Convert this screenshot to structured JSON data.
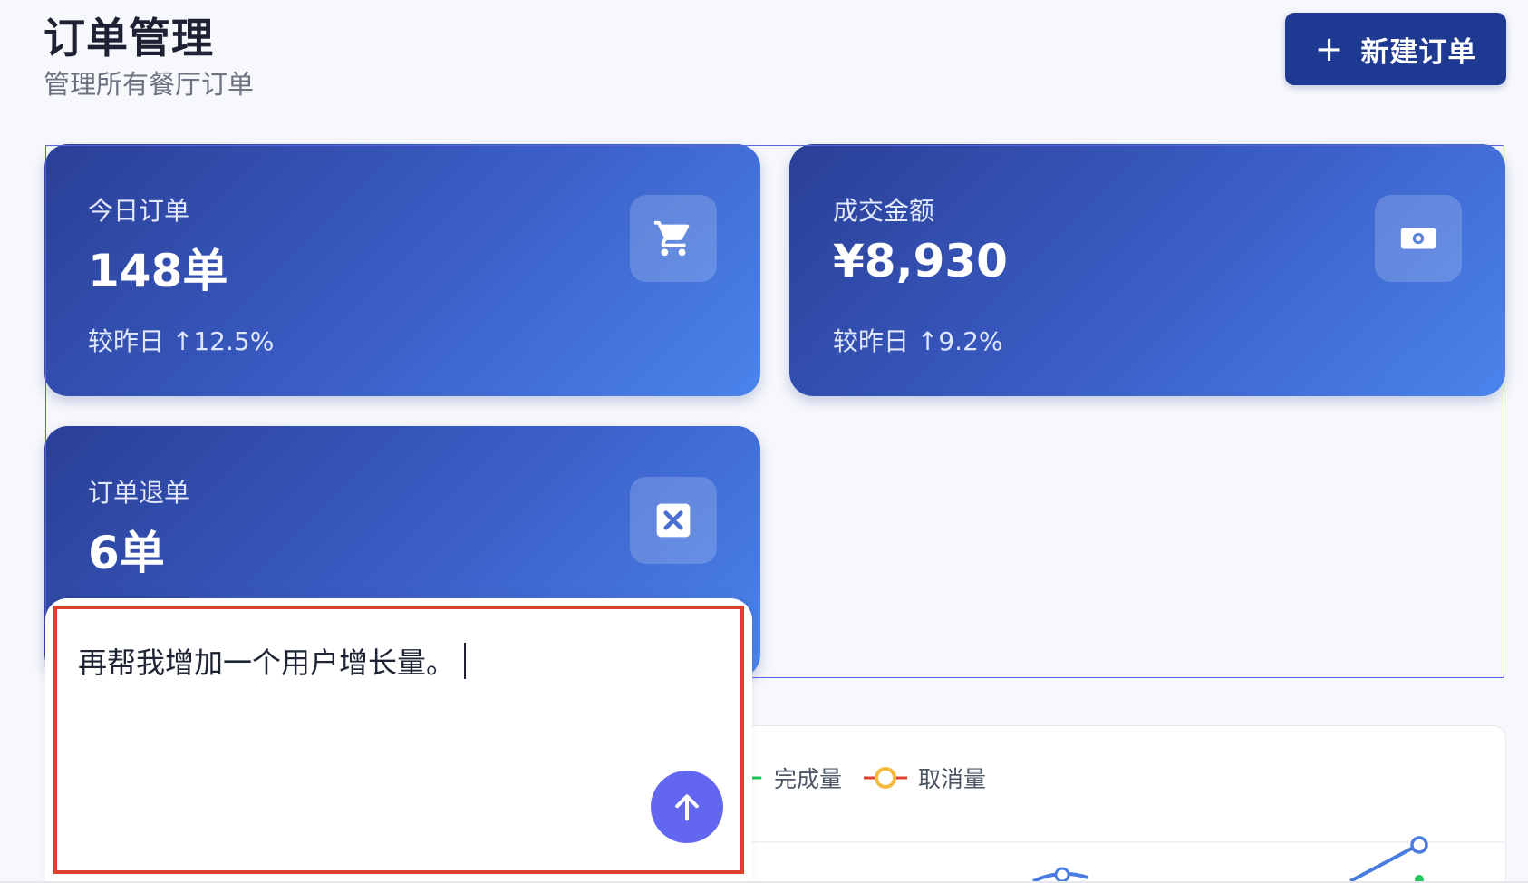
{
  "header": {
    "title": "订单管理",
    "subtitle": "管理所有餐厅订单",
    "new_order_label": "新建订单",
    "new_order_icon": "plus-icon"
  },
  "stats": [
    {
      "label": "今日订单",
      "value": "148单",
      "change": "较昨日 ↑12.5%",
      "icon": "shopping-cart-icon"
    },
    {
      "label": "成交金额",
      "value": "¥8,930",
      "change": "较昨日 ↑9.2%",
      "icon": "money-bill-icon"
    },
    {
      "label": "订单退单",
      "value": "6单",
      "icon": "cancel-x-icon"
    }
  ],
  "chart": {
    "legend": [
      {
        "label": "完成量",
        "color": "#22c55e"
      },
      {
        "label": "取消量",
        "color": "#f5b942",
        "line_color": "#e0402e"
      }
    ],
    "series_color": "#4a7be0"
  },
  "prompt": {
    "text": "再帮我增加一个用户增长量。",
    "send_icon": "arrow-up-icon"
  },
  "colors": {
    "primary": "#1f3a93",
    "card_start": "#2a3f96",
    "card_end": "#4a84ec",
    "send": "#6366f1",
    "highlight": "#e0402e"
  }
}
